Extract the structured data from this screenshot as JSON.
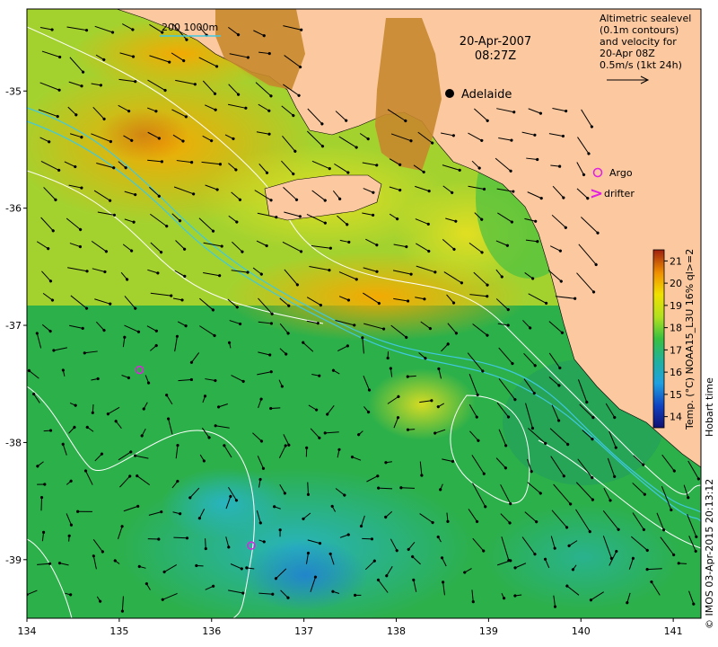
{
  "map": {
    "date_line1": "20-Apr-2007",
    "date_line2": "08:27Z",
    "scale_label": "200  1000m",
    "legend_note": [
      "Altimetric sealevel",
      "(0.1m contours)",
      "and velocity for",
      "20-Apr 08Z",
      "0.5m/s (1kt 24h)"
    ],
    "city": "Adelaide",
    "argo_label": "Argo",
    "drifter_label": "drifter",
    "drifter_symbol": ">",
    "colorbar_title": "Temp. (°C) NOAA15_L3U 16% ql>=2",
    "hobart_label": "Hobart time",
    "copyright": "© IMOS 03-Apr-2015 20:13:12",
    "colorbar_ticks": [
      "21",
      "20",
      "19",
      "18",
      "17",
      "16",
      "15",
      "14"
    ],
    "colorbar_range": [
      13.5,
      21.5
    ],
    "x_ticks": [
      "134",
      "135",
      "136",
      "137",
      "138",
      "139",
      "140",
      "141"
    ],
    "y_ticks": [
      "-35",
      "-36",
      "-37",
      "-38",
      "-39"
    ],
    "x_range": [
      134,
      141.3
    ],
    "y_range": [
      -34.3,
      -39.5
    ],
    "argo_floats": [
      [
        135.22,
        -37.38
      ],
      [
        136.43,
        -38.88
      ]
    ],
    "colors": {
      "land": "#fbc8a0",
      "argo": "#e020e0",
      "contour": "#ffffff",
      "isobath": "#40c8e0"
    }
  }
}
